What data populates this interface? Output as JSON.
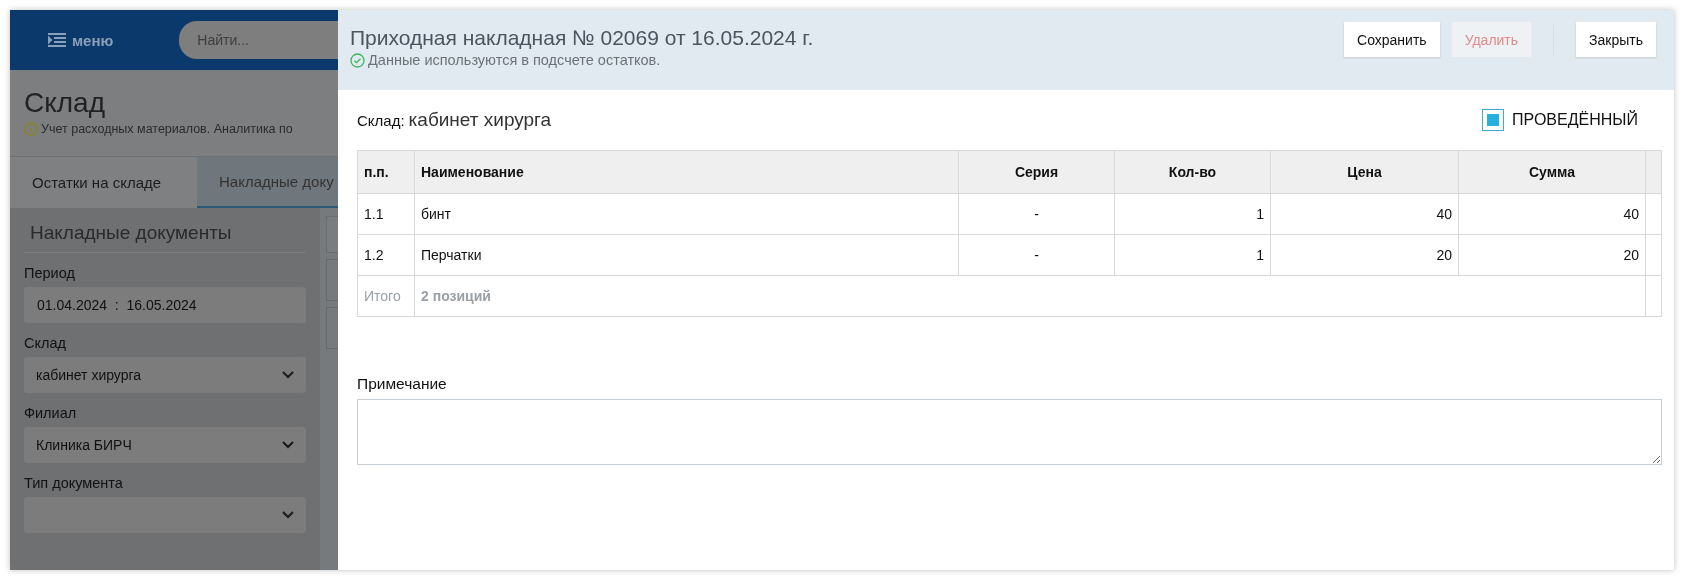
{
  "app": {
    "menu_label": "меню",
    "search": {
      "placeholder": "Найти..."
    },
    "page_title": "Склад",
    "page_hint": "Учет расходных материалов. Аналитика по",
    "tabs": [
      {
        "label": "Остатки на складе",
        "selected": false
      },
      {
        "label": "Накладные доку",
        "selected": true
      }
    ],
    "filters": {
      "title": "Накладные документы",
      "fields": [
        {
          "label": "Период",
          "kind": "text",
          "value": "01.04.2024  :  16.05.2024"
        },
        {
          "label": "Склад",
          "kind": "select",
          "value": "кабинет хирурга"
        },
        {
          "label": "Филиал",
          "kind": "select",
          "value": "Клиника БИРЧ"
        },
        {
          "label": "Тип документа",
          "kind": "select"
        }
      ]
    }
  },
  "dialog": {
    "title": "Приходная накладная № 02069 от 16.05.2024 г.",
    "status": "Данные используются в подсчете остатков.",
    "buttons": [
      {
        "label": "Сохранить",
        "disabled": false
      },
      {
        "label": "Удалить",
        "disabled": true
      },
      {
        "label": "Закрыть",
        "disabled": false
      }
    ],
    "warehouse": {
      "label": "Склад:",
      "value": "кабинет хирурга"
    },
    "posted": {
      "label": "ПРОВЕДЁННЫЙ",
      "checked": true
    },
    "table": {
      "columns": [
        "п.п.",
        "Наименование",
        "Серия",
        "Кол-во",
        "Цена",
        "Сумма"
      ],
      "rows": [
        [
          "1.1",
          "бинт",
          "-",
          "1",
          "40",
          "40"
        ],
        [
          "1.2",
          "Перчатки",
          "-",
          "1",
          "20",
          "20"
        ]
      ],
      "total": {
        "label": "Итого",
        "text": "2 позиций"
      }
    },
    "note": {
      "label": "Примечание"
    }
  }
}
